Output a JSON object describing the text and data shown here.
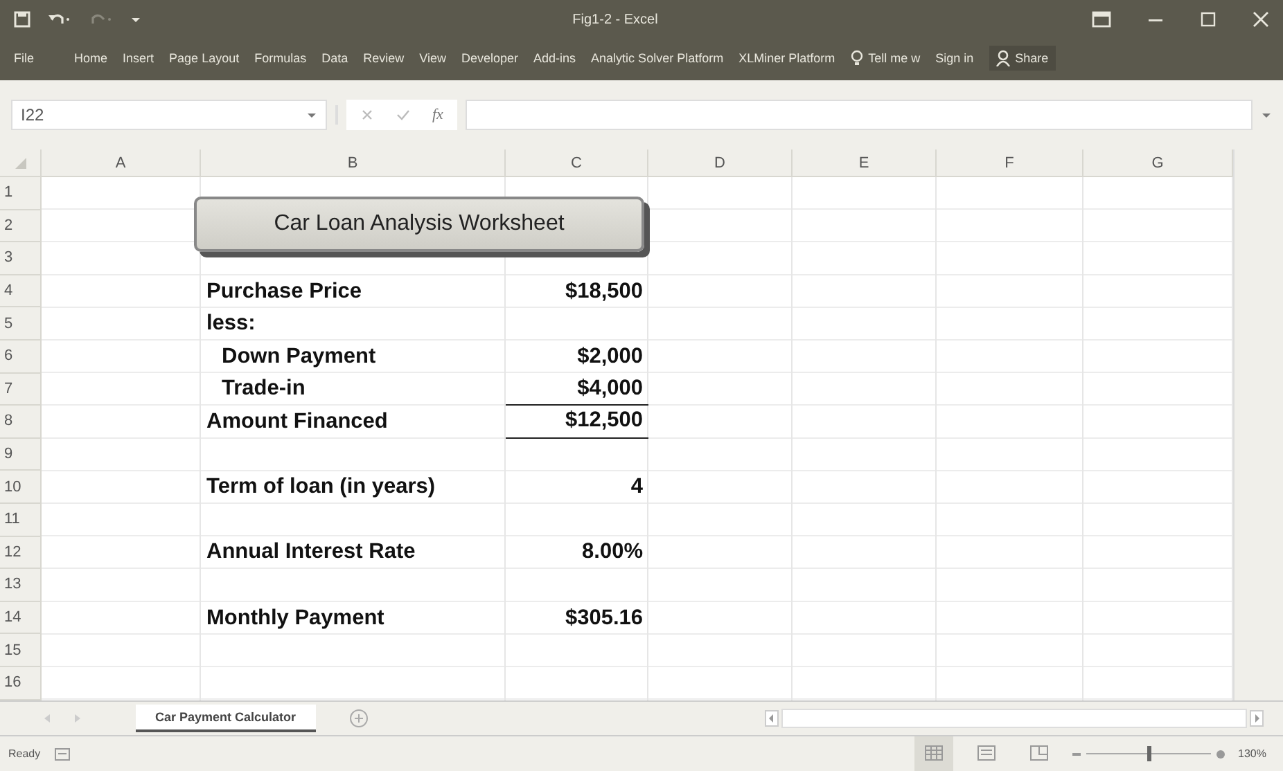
{
  "window": {
    "title": "Fig1-2 - Excel"
  },
  "ribbon_tabs": [
    {
      "label": "File",
      "selected": false
    },
    {
      "label": "Home",
      "selected": false
    },
    {
      "label": "Insert",
      "selected": false
    },
    {
      "label": "Page Layout",
      "selected": false
    },
    {
      "label": "Formulas",
      "selected": false
    },
    {
      "label": "Data",
      "selected": false
    },
    {
      "label": "Review",
      "selected": false
    },
    {
      "label": "View",
      "selected": false
    },
    {
      "label": "Developer",
      "selected": false
    },
    {
      "label": "Add-ins",
      "selected": false
    },
    {
      "label": "Analytic Solver Platform",
      "selected": false
    },
    {
      "label": "XLMiner Platform",
      "selected": false
    }
  ],
  "tell_me": "Tell me w",
  "sign_in": "Sign in",
  "share": "Share",
  "name_box": "I22",
  "function_label": "fx",
  "columns": [
    "A",
    "B",
    "C",
    "D",
    "E",
    "F",
    "G"
  ],
  "text_box": "Car Loan Analysis Worksheet",
  "rows": [
    {
      "label": "1"
    },
    {
      "label": "2"
    },
    {
      "label": "3"
    },
    {
      "label": "4",
      "b": {
        "text": "Purchase Price"
      },
      "c": {
        "text": "$18,500",
        "underline": false
      }
    },
    {
      "label": "5",
      "b": {
        "text": "less:"
      }
    },
    {
      "label": "6",
      "b": {
        "text": "Down Payment",
        "indented": true
      },
      "c": {
        "text": "$2,000",
        "underline": false
      }
    },
    {
      "label": "7",
      "b": {
        "text": "Trade-in",
        "indented": true
      },
      "c": {
        "text": "$4,000",
        "underline": true
      }
    },
    {
      "label": "8",
      "b": {
        "text": "Amount Financed"
      },
      "c": {
        "text": "$12,500",
        "underline": true
      }
    },
    {
      "label": "9"
    },
    {
      "label": "10",
      "b": {
        "text": "Term of loan (in years)"
      },
      "c": {
        "text": "4",
        "underline": false
      }
    },
    {
      "label": "11"
    },
    {
      "label": "12",
      "b": {
        "text": "Annual Interest Rate"
      },
      "c": {
        "text": "8.00%",
        "underline": false
      }
    },
    {
      "label": "13"
    },
    {
      "label": "14",
      "b": {
        "text": "Monthly Payment"
      },
      "c": {
        "text": "$305.16",
        "underline": false
      }
    },
    {
      "label": "15"
    },
    {
      "label": "16"
    }
  ],
  "sheet_tabs": [
    {
      "label": "Car Payment Calculator",
      "selected": true
    }
  ],
  "status": "Ready",
  "views": [
    {
      "kind": "normal",
      "selected": true
    },
    {
      "kind": "layout",
      "selected": false
    },
    {
      "kind": "break",
      "selected": false
    }
  ],
  "zoom": {
    "level": 0.5,
    "reading": "130%"
  }
}
